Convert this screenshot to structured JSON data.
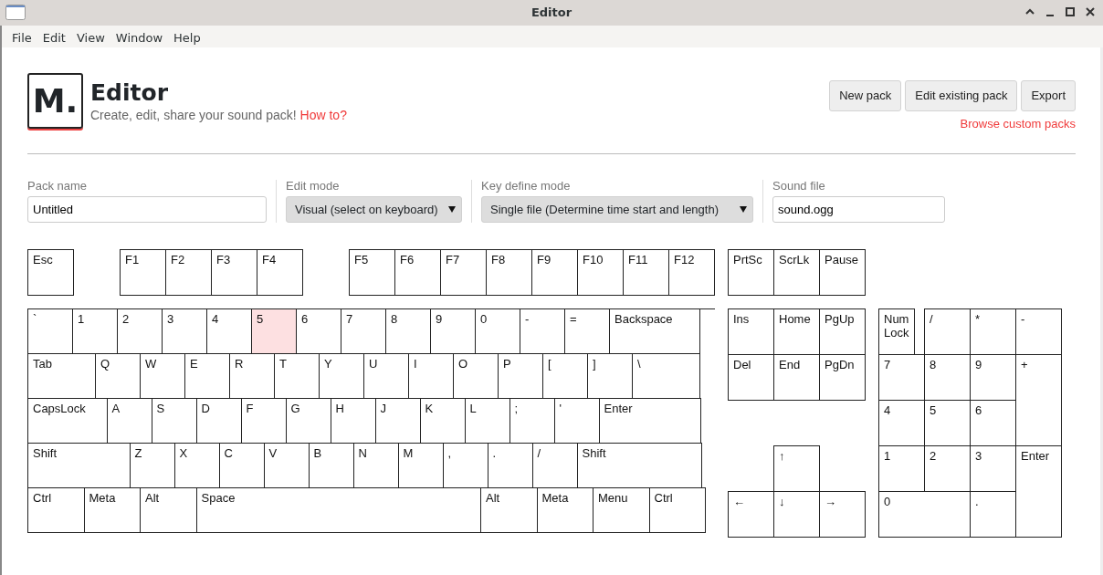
{
  "window": {
    "title": "Editor"
  },
  "menu": [
    "File",
    "Edit",
    "View",
    "Window",
    "Help"
  ],
  "header": {
    "logo": "M.",
    "title": "Editor",
    "subtitle": "Create, edit, share your sound pack!",
    "help_link": "How to?",
    "buttons": [
      "New pack",
      "Edit existing pack",
      "Export"
    ],
    "browse_link": "Browse custom packs"
  },
  "form": [
    {
      "kind": "text",
      "label": "Pack name",
      "value": "Untitled"
    },
    {
      "kind": "select",
      "label": "Edit mode",
      "value": "Visual (select on keyboard)"
    },
    {
      "kind": "select",
      "label": "Key define mode",
      "value": "Single file (Determine time start and length)"
    },
    {
      "kind": "text",
      "label": "Sound file",
      "value": "sound.ogg"
    }
  ],
  "keyboard": {
    "function_keys": [
      {
        "label": "Esc",
        "selected": false
      },
      {
        "label": "F1",
        "selected": false
      },
      {
        "label": "F2",
        "selected": false
      },
      {
        "label": "F3",
        "selected": false
      },
      {
        "label": "F4",
        "selected": false
      },
      {
        "label": "F5",
        "selected": false
      },
      {
        "label": "F6",
        "selected": false
      },
      {
        "label": "F7",
        "selected": false
      },
      {
        "label": "F8",
        "selected": false
      },
      {
        "label": "F9",
        "selected": false
      },
      {
        "label": "F10",
        "selected": false
      },
      {
        "label": "F11",
        "selected": false
      },
      {
        "label": "F12",
        "selected": false
      }
    ],
    "system_keys": [
      {
        "label": "PrtSc",
        "selected": false
      },
      {
        "label": "ScrLk",
        "selected": false
      },
      {
        "label": "Pause",
        "selected": false
      }
    ],
    "main_rows": [
      [
        {
          "label": "`",
          "selected": false
        },
        {
          "label": "1",
          "selected": false
        },
        {
          "label": "2",
          "selected": false
        },
        {
          "label": "3",
          "selected": false
        },
        {
          "label": "4",
          "selected": false
        },
        {
          "label": "5",
          "selected": true
        },
        {
          "label": "6",
          "selected": false
        },
        {
          "label": "7",
          "selected": false
        },
        {
          "label": "8",
          "selected": false
        },
        {
          "label": "9",
          "selected": false
        },
        {
          "label": "0",
          "selected": false
        },
        {
          "label": "-",
          "selected": false
        },
        {
          "label": "=",
          "selected": false
        },
        {
          "label": "Backspace",
          "selected": false
        }
      ],
      [
        {
          "label": "Tab",
          "selected": false
        },
        {
          "label": "Q",
          "selected": false
        },
        {
          "label": "W",
          "selected": false
        },
        {
          "label": "E",
          "selected": false
        },
        {
          "label": "R",
          "selected": false
        },
        {
          "label": "T",
          "selected": false
        },
        {
          "label": "Y",
          "selected": false
        },
        {
          "label": "U",
          "selected": false
        },
        {
          "label": "I",
          "selected": false
        },
        {
          "label": "O",
          "selected": false
        },
        {
          "label": "P",
          "selected": false
        },
        {
          "label": "[",
          "selected": false
        },
        {
          "label": "]",
          "selected": false
        },
        {
          "label": "\\",
          "selected": false
        }
      ],
      [
        {
          "label": "CapsLock",
          "selected": false
        },
        {
          "label": "A",
          "selected": false
        },
        {
          "label": "S",
          "selected": false
        },
        {
          "label": "D",
          "selected": false
        },
        {
          "label": "F",
          "selected": false
        },
        {
          "label": "G",
          "selected": false
        },
        {
          "label": "H",
          "selected": false
        },
        {
          "label": "J",
          "selected": false
        },
        {
          "label": "K",
          "selected": false
        },
        {
          "label": "L",
          "selected": false
        },
        {
          "label": ";",
          "selected": false
        },
        {
          "label": "'",
          "selected": false
        },
        {
          "label": "Enter",
          "selected": false
        }
      ],
      [
        {
          "label": "Shift",
          "selected": false
        },
        {
          "label": "Z",
          "selected": false
        },
        {
          "label": "X",
          "selected": false
        },
        {
          "label": "C",
          "selected": false
        },
        {
          "label": "V",
          "selected": false
        },
        {
          "label": "B",
          "selected": false
        },
        {
          "label": "N",
          "selected": false
        },
        {
          "label": "M",
          "selected": false
        },
        {
          "label": ",",
          "selected": false
        },
        {
          "label": ".",
          "selected": false
        },
        {
          "label": "/",
          "selected": false
        },
        {
          "label": "Shift",
          "selected": false
        }
      ],
      [
        {
          "label": "Ctrl",
          "selected": false
        },
        {
          "label": "Meta",
          "selected": false
        },
        {
          "label": "Alt",
          "selected": false
        },
        {
          "label": "Space",
          "selected": false
        },
        {
          "label": "Alt",
          "selected": false
        },
        {
          "label": "Meta",
          "selected": false
        },
        {
          "label": "Menu",
          "selected": false
        },
        {
          "label": "Ctrl",
          "selected": false
        }
      ]
    ],
    "nav_keys": [
      {
        "label": "Ins",
        "selected": false
      },
      {
        "label": "Home",
        "selected": false
      },
      {
        "label": "PgUp",
        "selected": false
      },
      {
        "label": "Del",
        "selected": false
      },
      {
        "label": "End",
        "selected": false
      },
      {
        "label": "PgDn",
        "selected": false
      },
      {
        "label": "↑",
        "selected": false
      },
      {
        "label": "←",
        "selected": false
      },
      {
        "label": "↓",
        "selected": false
      },
      {
        "label": "→",
        "selected": false
      }
    ],
    "numpad_keys": [
      {
        "label": "Num Lock",
        "selected": false
      },
      {
        "label": "/",
        "selected": false
      },
      {
        "label": "*",
        "selected": false
      },
      {
        "label": "-",
        "selected": false
      },
      {
        "label": "7",
        "selected": false
      },
      {
        "label": "8",
        "selected": false
      },
      {
        "label": "9",
        "selected": false
      },
      {
        "label": "+",
        "selected": false
      },
      {
        "label": "4",
        "selected": false
      },
      {
        "label": "5",
        "selected": false
      },
      {
        "label": "6",
        "selected": false
      },
      {
        "label": "1",
        "selected": false
      },
      {
        "label": "2",
        "selected": false
      },
      {
        "label": "3",
        "selected": false
      },
      {
        "label": "Enter",
        "selected": false
      },
      {
        "label": "0",
        "selected": false
      },
      {
        "label": ".",
        "selected": false
      }
    ]
  }
}
